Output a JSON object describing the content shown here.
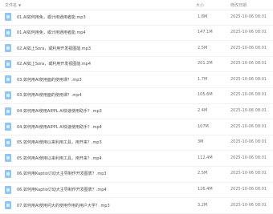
{
  "header": {
    "name_label": "文件名",
    "size_label": "大小",
    "date_label": "修改日期"
  },
  "files": [
    {
      "name": "01.AI如何用免，或计用通用者能.mp3",
      "size": "1.8M",
      "date": "2025-10-06 08:01"
    },
    {
      "name": "01.AI如何用免，或计用通用者能.mp4",
      "size": "147.1M",
      "date": "2025-10-06 08:01"
    },
    {
      "name": "02.AI如上Sora，或利用开发视图能.mp3",
      "size": "2.5M",
      "date": "2025-10-06 08:01"
    },
    {
      "name": "02.AI如上Sora，或利用开发视图能.mp4",
      "size": "201.2M",
      "date": "2025-10-06 08:01"
    },
    {
      "name": "03.如何用AI使用面的使用课？.mp3",
      "size": "1.7M",
      "date": "2025-10-06 08:01"
    },
    {
      "name": "03.如何用AI使用面的使用课？.mp4",
      "size": "105.6M",
      "date": "2025-10-06 08:01"
    },
    {
      "name": "04.如何用AI使用AIPPL AI快速使用助手？.mp3",
      "size": "2.4M",
      "date": "2025-10-06 08:01"
    },
    {
      "name": "04.如何用AI使用AIPPL AI快速使用助手？.mp4",
      "size": "107M",
      "date": "2025-10-06 08:01"
    },
    {
      "name": "05.如何用AI使用以来利用工具，用开来？.mp3",
      "size": "3M",
      "date": "2025-10-06 08:01"
    },
    {
      "name": "05.如何用AI使用以来利用工具，用开来？.mp4",
      "size": "112.4M",
      "date": "2025-10-06 08:01"
    },
    {
      "name": "06.如何用Kaptio订动大主导制作开发图表？.mp3",
      "size": "2.5M",
      "date": "2025-10-06 08:01"
    },
    {
      "name": "06.如何用Kaptio订动大主导制作开发图表？.mp4",
      "size": "126.4M",
      "date": "2025-10-06 08:01"
    },
    {
      "name": "07.如何用AI使用问大的使用作用的用户大学？.mp3",
      "size": "3.2M",
      "date": "2025-10-06 08:01"
    }
  ]
}
